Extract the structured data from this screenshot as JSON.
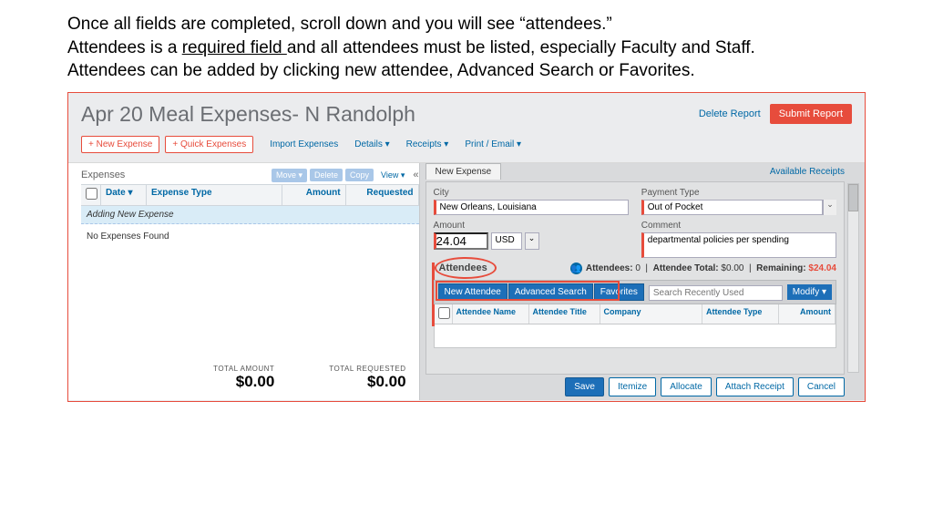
{
  "instruction": {
    "l1a": "Once all fields are completed, scroll down and you will see “attendees.”",
    "l2a": "Attendees is a ",
    "l2u": "required field ",
    "l2b": "and all attendees must be listed, especially Faculty and Staff.",
    "l3": "Attendees can be added by clicking new attendee, Advanced Search or Favorites."
  },
  "header": {
    "title": "Apr 20 Meal Expenses- N Randolph",
    "delete": "Delete Report",
    "submit": "Submit Report"
  },
  "toolbar": {
    "newexp": "+ New Expense",
    "quick": "+ Quick Expenses",
    "import": "Import Expenses",
    "details": "Details ▾",
    "receipts": "Receipts ▾",
    "print": "Print / Email ▾"
  },
  "left": {
    "heading": "Expenses",
    "move": "Move ▾",
    "delete": "Delete",
    "copy": "Copy",
    "view": "View ▾",
    "col_date": "Date ▾",
    "col_type": "Expense Type",
    "col_amt": "Amount",
    "col_req": "Requested",
    "adding": "Adding New Expense",
    "none": "No Expenses Found",
    "tot_a_lbl": "TOTAL AMOUNT",
    "tot_a": "$0.00",
    "tot_r_lbl": "TOTAL REQUESTED",
    "tot_r": "$0.00"
  },
  "right": {
    "tab": "New Expense",
    "avr": "Available Receipts",
    "f": {
      "city_l": "City",
      "city": "New Orleans, Louisiana",
      "pay_l": "Payment Type",
      "pay": "Out of Pocket",
      "amt_l": "Amount",
      "amt": "24.04",
      "cur": "USD",
      "com_l": "Comment",
      "com": "departmental policies per spending"
    },
    "att": {
      "title": "Attendees",
      "count_l": "Attendees:",
      "count": "0",
      "tot_l": "Attendee Total:",
      "tot": "$0.00",
      "rem_l": "Remaining:",
      "rem": "$24.04",
      "new": "New Attendee",
      "adv": "Advanced Search",
      "fav": "Favorites",
      "search_ph": "Search Recently Used",
      "mod": "Modify ▾",
      "c_name": "Attendee Name",
      "c_title": "Attendee Title",
      "c_comp": "Company",
      "c_type": "Attendee Type",
      "c_amt": "Amount"
    },
    "foot": {
      "save": "Save",
      "item": "Itemize",
      "alloc": "Allocate",
      "attach": "Attach Receipt",
      "cancel": "Cancel"
    }
  }
}
